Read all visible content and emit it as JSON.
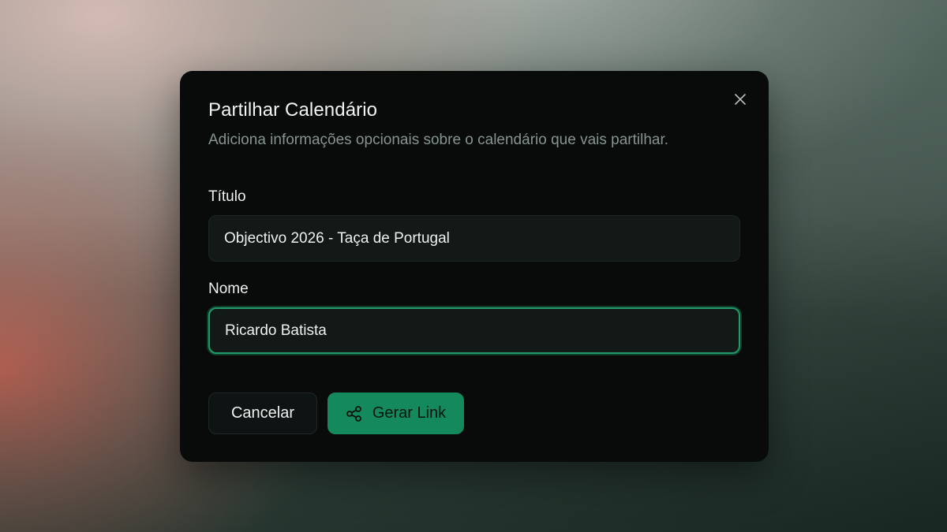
{
  "dialog": {
    "title": "Partilhar Calendário",
    "description": "Adiciona informações opcionais sobre o calendário que vais partilhar.",
    "close_icon": "close-icon"
  },
  "form": {
    "title_label": "Título",
    "title_value": "Objectivo 2026 - Taça de Portugal",
    "name_label": "Nome",
    "name_value": "Ricardo Batista",
    "name_focused": true
  },
  "actions": {
    "cancel_label": "Cancelar",
    "generate_label": "Gerar Link",
    "generate_icon": "share-icon"
  },
  "colors": {
    "dialog_bg": "#080b0a",
    "accent": "#14895c",
    "focus_ring": "#1f9a68",
    "muted_text": "#879590"
  }
}
